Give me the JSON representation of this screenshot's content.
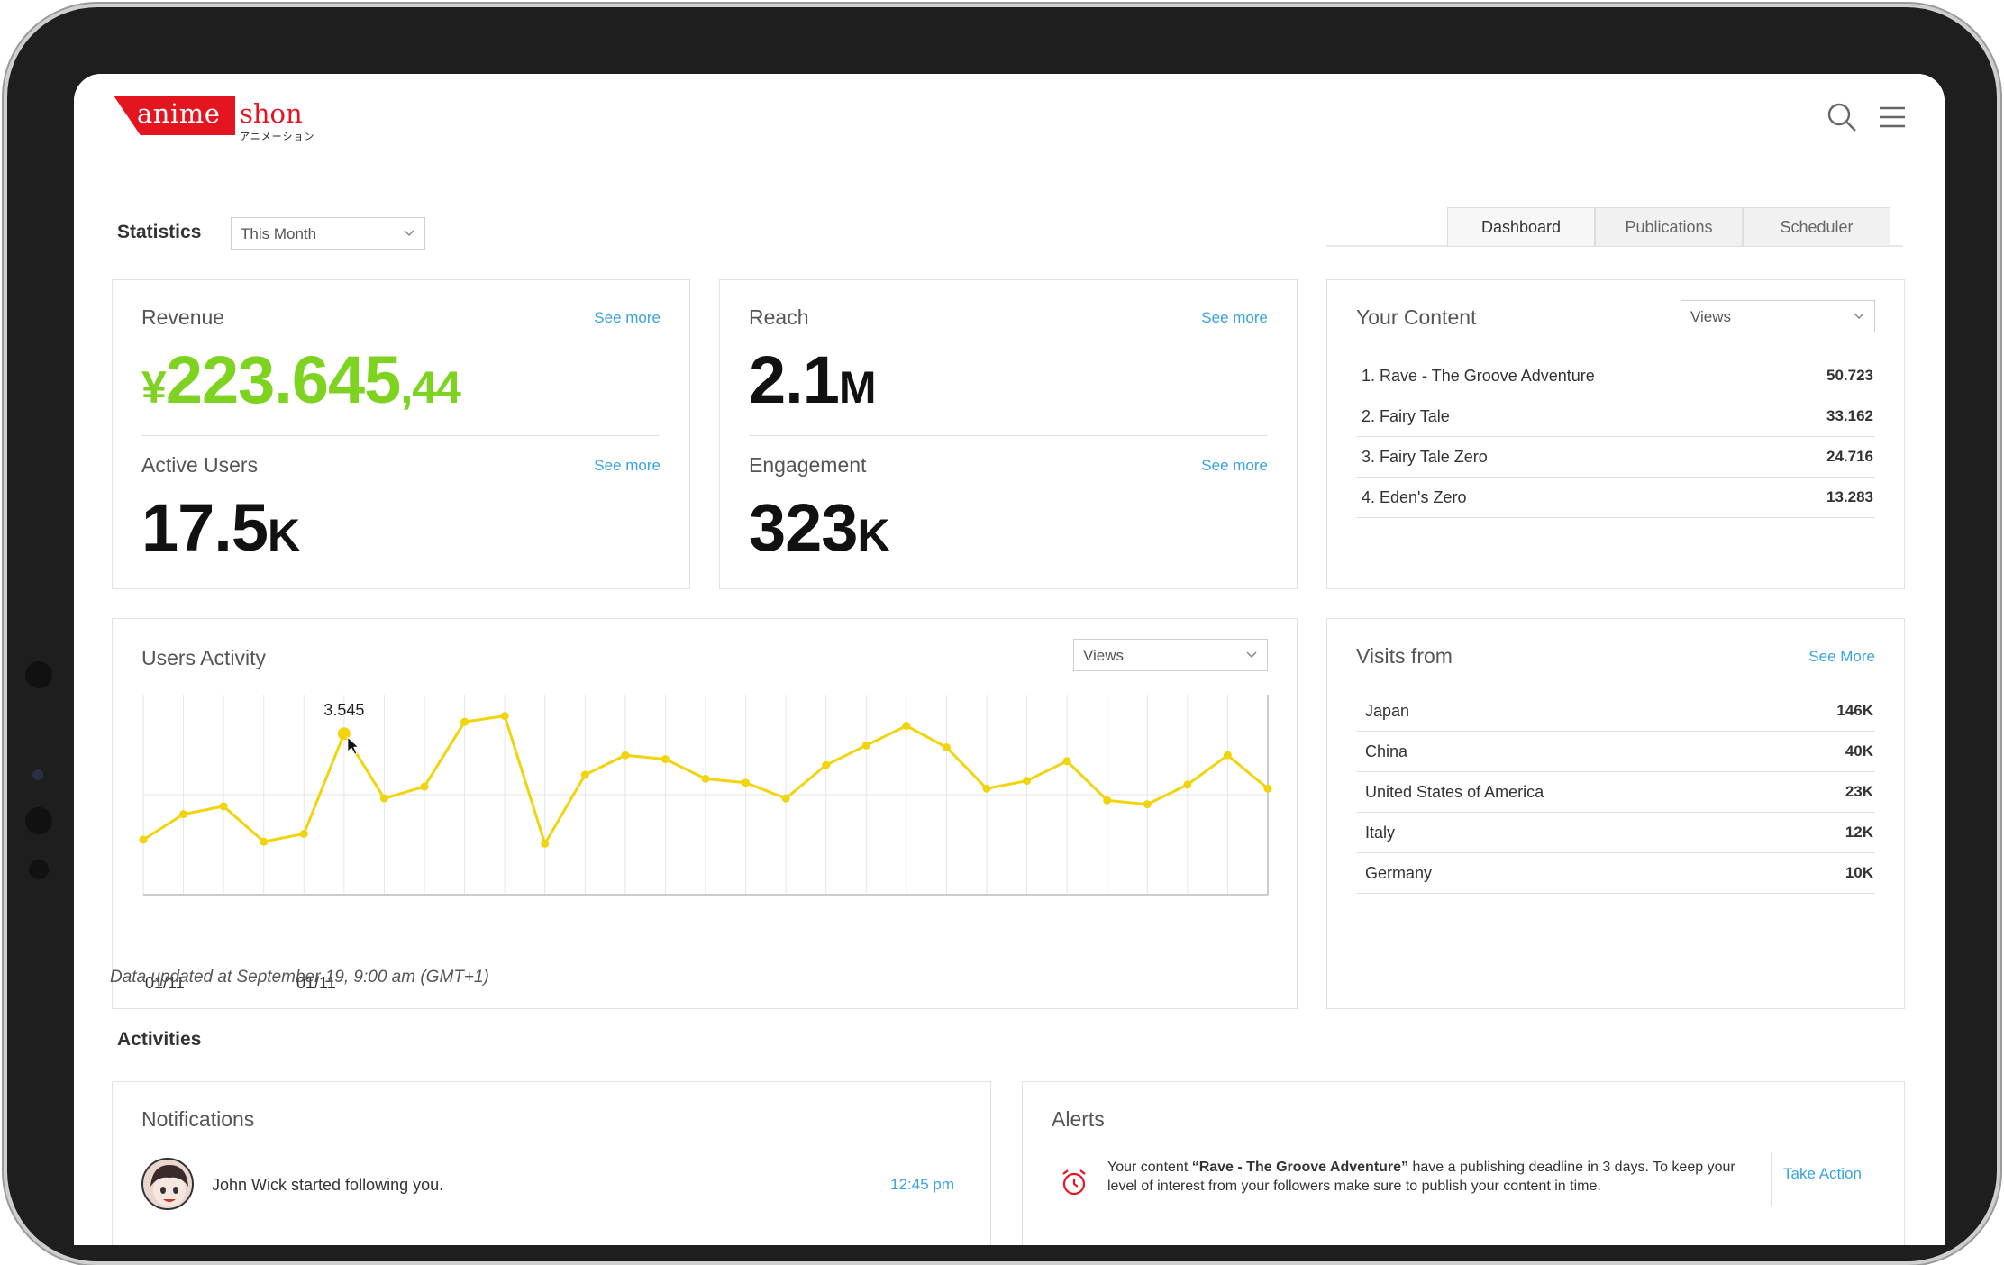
{
  "brand": {
    "name_left": "anime",
    "name_right": "shon",
    "subtitle": "アニメーション",
    "color": "#e4151f"
  },
  "header": {
    "icons": [
      "search-icon",
      "menu-icon"
    ]
  },
  "statistics": {
    "title": "Statistics",
    "period": "This Month",
    "tabs": [
      {
        "label": "Dashboard",
        "active": true
      },
      {
        "label": "Publications",
        "active": false
      },
      {
        "label": "Scheduler",
        "active": false
      }
    ]
  },
  "kpis": {
    "revenue": {
      "label": "Revenue",
      "see_more": "See more",
      "prefix": "¥",
      "value": "223.645",
      "cents": ",44",
      "color": "#7ed321"
    },
    "active_users": {
      "label": "Active Users",
      "see_more": "See more",
      "value": "17.5",
      "unit": "K"
    },
    "reach": {
      "label": "Reach",
      "see_more": "See more",
      "value": "2.1",
      "unit": "M"
    },
    "engagement": {
      "label": "Engagement",
      "see_more": "See more",
      "value": "323",
      "unit": "K"
    }
  },
  "your_content": {
    "title": "Your Content",
    "metric": "Views",
    "items": [
      {
        "name": "1. Rave - The Groove Adventure",
        "value": "50.723"
      },
      {
        "name": "2. Fairy Tale",
        "value": "33.162"
      },
      {
        "name": "3. Fairy Tale Zero",
        "value": "24.716"
      },
      {
        "name": "4. Eden's Zero",
        "value": "13.283"
      }
    ]
  },
  "users_activity": {
    "title": "Users Activity",
    "metric": "Views",
    "tooltip": "3.545",
    "x_labels": [
      "01/11",
      "01/11"
    ]
  },
  "chart_data": {
    "type": "line",
    "series": [
      {
        "values": [
          0.28,
          0.41,
          0.45,
          0.27,
          0.31,
          0.82,
          0.49,
          0.55,
          0.88,
          0.91,
          0.26,
          0.61,
          0.71,
          0.69,
          0.59,
          0.57,
          0.49,
          0.66,
          0.76,
          0.86,
          0.75,
          0.54,
          0.58,
          0.68,
          0.48,
          0.46,
          0.56,
          0.71,
          0.54
        ]
      }
    ],
    "highlight_index": 5,
    "highlight_label": "3.545",
    "color": "#f2d40c",
    "grid": true
  },
  "visits_from": {
    "title": "Visits from",
    "see_more": "See More",
    "items": [
      {
        "name": "Japan",
        "value": "146K"
      },
      {
        "name": "China",
        "value": "40K"
      },
      {
        "name": "United States of America",
        "value": "23K"
      },
      {
        "name": "Italy",
        "value": "12K"
      },
      {
        "name": "Germany",
        "value": "10K"
      }
    ]
  },
  "updated_note": "Data updated at September 19, 9:00 am (GMT+1)",
  "activities": {
    "title": "Activities",
    "notifications": {
      "title": "Notifications",
      "items": [
        {
          "text": "John Wick started following you.",
          "time": "12:45 pm"
        }
      ]
    },
    "alerts": {
      "title": "Alerts",
      "items": [
        {
          "pre": "Your content ",
          "highlight": "“Rave - The Groove Adventure”",
          "post": " have a publishing deadline in 3 days. To keep your level of interest from your followers make sure to publish your content in time.",
          "action": "Take Action"
        }
      ]
    }
  }
}
